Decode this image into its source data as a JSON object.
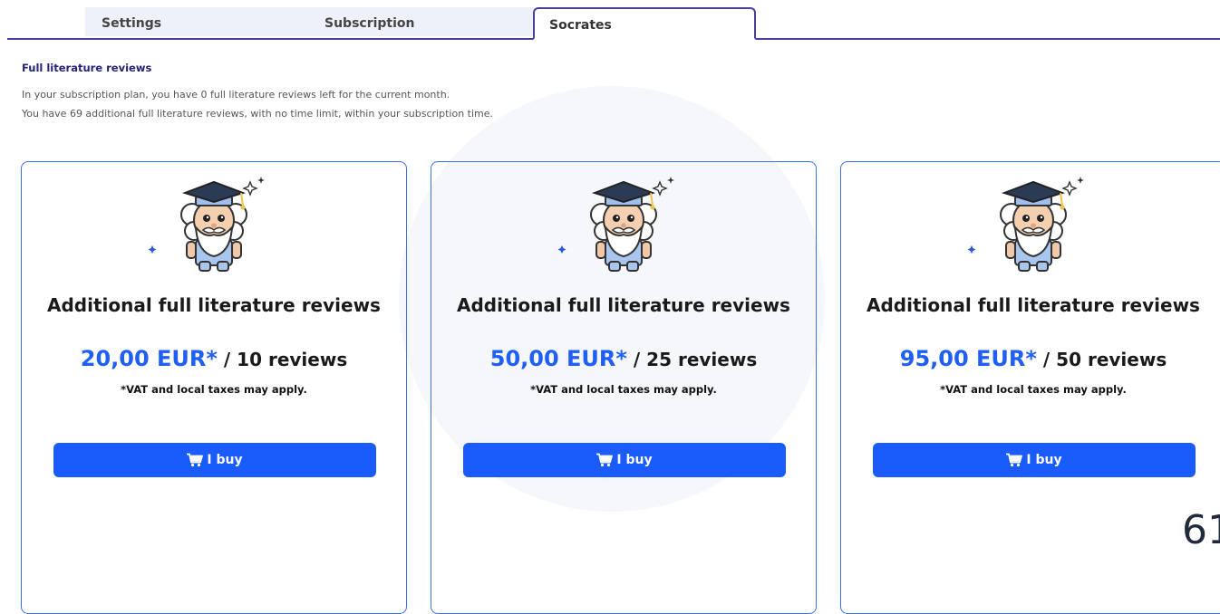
{
  "tabs": [
    {
      "label": "Settings",
      "active": false
    },
    {
      "label": "Subscription",
      "active": false
    },
    {
      "label": "Socrates",
      "active": true
    }
  ],
  "section": {
    "title": "Full literature reviews",
    "info_line1": "In your subscription plan, you have 0 full literature reviews left for the current month.",
    "info_line2": "You have 69 additional full literature reviews, with no time limit, within your subscription time."
  },
  "cards": [
    {
      "title": "Additional full literature reviews",
      "price": "20,00 EUR*",
      "per": " / 10 reviews",
      "vat": "*VAT and local taxes may apply.",
      "button": "I buy"
    },
    {
      "title": "Additional full literature reviews",
      "price": "50,00 EUR*",
      "per": " / 25 reviews",
      "vat": "*VAT and local taxes may apply.",
      "button": "I buy"
    },
    {
      "title": "Additional full literature reviews",
      "price": "95,00 EUR*",
      "per": " / 50 reviews",
      "vat": "*VAT and local taxes may apply.",
      "button": "I buy"
    }
  ],
  "page_number": "61",
  "colors": {
    "accent": "#1a5cfb",
    "price": "#1f5ff5",
    "tab_border": "#4a3f9a",
    "card_border": "#3b6ef0",
    "title_dark": "#23237a"
  },
  "icons": {
    "mascot": "socrates-graduate-mascot",
    "button": "cart-icon"
  }
}
